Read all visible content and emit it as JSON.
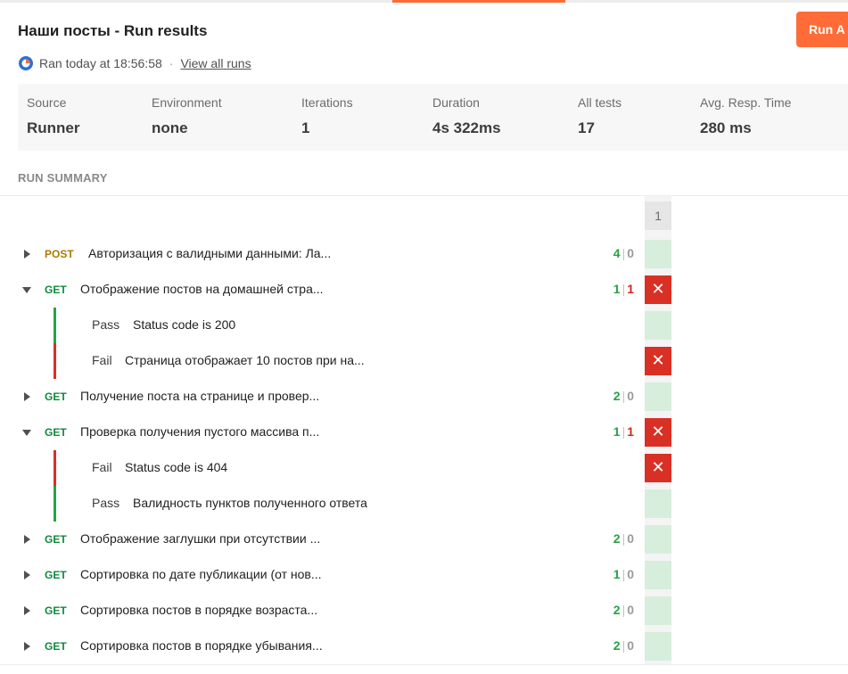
{
  "header": {
    "title": "Наши посты - Run results",
    "run_all_label": "Run A",
    "ran_text": "Ran today at 18:56:58",
    "separator": "·",
    "view_all_runs": "View all runs"
  },
  "stats": [
    {
      "label": "Source",
      "value": "Runner"
    },
    {
      "label": "Environment",
      "value": "none"
    },
    {
      "label": "Iterations",
      "value": "1"
    },
    {
      "label": "Duration",
      "value": "4s 322ms"
    },
    {
      "label": "All tests",
      "value": "17"
    },
    {
      "label": "Avg. Resp. Time",
      "value": "280 ms"
    }
  ],
  "summary": {
    "label": "RUN SUMMARY",
    "iteration_header": "1",
    "fail_icon": "close-icon",
    "rows": [
      {
        "kind": "request",
        "expanded": false,
        "method": "POST",
        "name": "Авторизация с валидными данными: Ла...",
        "passed": "4",
        "failed": "0",
        "status": "pass"
      },
      {
        "kind": "request",
        "expanded": true,
        "method": "GET",
        "name": "Отображение постов на домашней стра...",
        "passed": "1",
        "failed": "1",
        "status": "fail"
      },
      {
        "kind": "test",
        "result": "Pass",
        "name": "Status code is 200",
        "status": "pass"
      },
      {
        "kind": "test",
        "result": "Fail",
        "name": "Страница отображает 10 постов при на...",
        "status": "fail"
      },
      {
        "kind": "request",
        "expanded": false,
        "method": "GET",
        "name": "Получение поста на странице и провер...",
        "passed": "2",
        "failed": "0",
        "status": "pass"
      },
      {
        "kind": "request",
        "expanded": true,
        "method": "GET",
        "name": "Проверка получения пустого массива п...",
        "passed": "1",
        "failed": "1",
        "status": "fail"
      },
      {
        "kind": "test",
        "result": "Fail",
        "name": "Status code is 404",
        "status": "fail"
      },
      {
        "kind": "test",
        "result": "Pass",
        "name": "Валидность пунктов полученного ответа",
        "status": "pass"
      },
      {
        "kind": "request",
        "expanded": false,
        "method": "GET",
        "name": "Отображение заглушки при отсутствии ...",
        "passed": "2",
        "failed": "0",
        "status": "pass"
      },
      {
        "kind": "request",
        "expanded": false,
        "method": "GET",
        "name": "Сортировка по дате публикации (от нов...",
        "passed": "1",
        "failed": "0",
        "status": "pass"
      },
      {
        "kind": "request",
        "expanded": false,
        "method": "GET",
        "name": "Сортировка постов в порядке возраста...",
        "passed": "2",
        "failed": "0",
        "status": "pass"
      },
      {
        "kind": "request",
        "expanded": false,
        "method": "GET",
        "name": "Сортировка постов в порядке убывания...",
        "passed": "2",
        "failed": "0",
        "status": "pass"
      }
    ]
  },
  "colors": {
    "accent": "#ff6c37",
    "pass": "#26a345",
    "fail": "#d93025",
    "post_method": "#ad7a03",
    "get_method": "#0f8a3c"
  }
}
